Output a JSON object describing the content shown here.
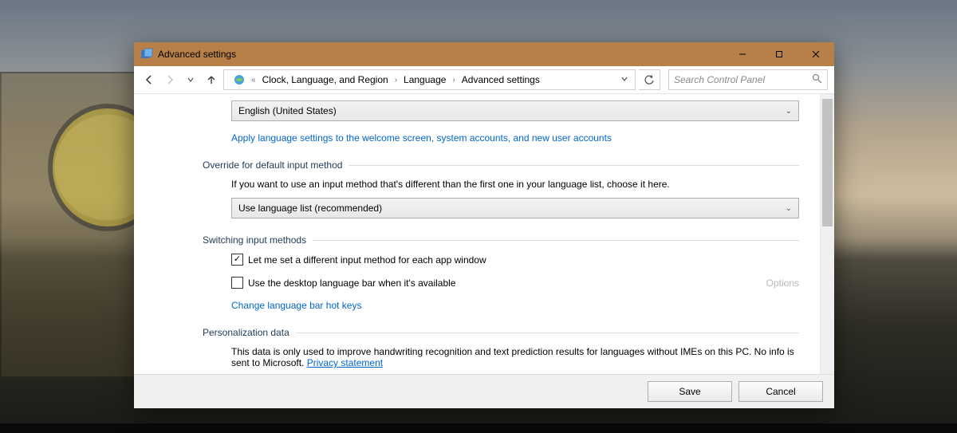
{
  "window": {
    "title": "Advanced settings"
  },
  "breadcrumbs": {
    "level1": "Clock, Language, and Region",
    "level2": "Language",
    "level3": "Advanced settings"
  },
  "search": {
    "placeholder": "Search Control Panel"
  },
  "display_language": {
    "selected": "English (United States)",
    "apply_link": "Apply language settings to the welcome screen, system accounts, and new user accounts"
  },
  "override_input": {
    "heading": "Override for default input method",
    "description": "If you want to use an input method that's different than the first one in your language list, choose it here.",
    "selected": "Use language list (recommended)"
  },
  "switching": {
    "heading": "Switching input methods",
    "cb1_label": "Let me set a different input method for each app window",
    "cb1_checked": true,
    "cb2_label": "Use the desktop language bar when it's available",
    "cb2_checked": false,
    "options_label": "Options",
    "hotkeys_link": "Change language bar hot keys"
  },
  "personalization": {
    "heading": "Personalization data",
    "description_a": "This data is only used to improve handwriting recognition and text prediction results for languages without IMEs on this PC. No info is sent to Microsoft. ",
    "privacy_link": "Privacy statement"
  },
  "footer": {
    "save": "Save",
    "cancel": "Cancel"
  }
}
